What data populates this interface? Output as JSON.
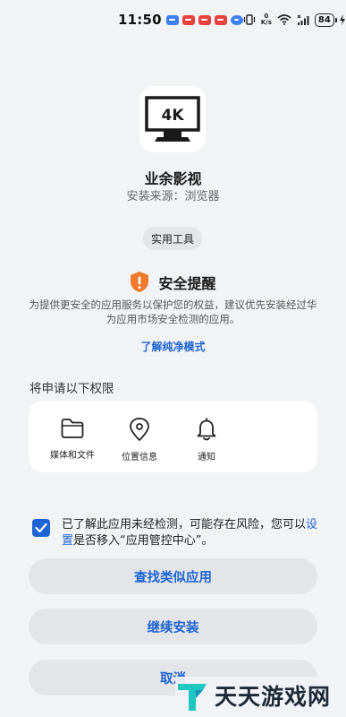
{
  "status_bar": {
    "time": "11:50",
    "net_speed_value": "0",
    "net_speed_unit": "K/s",
    "battery": "84"
  },
  "app": {
    "icon_text": "4K",
    "name": "业余影视",
    "source": "安装来源：浏览器",
    "category": "实用工具"
  },
  "security": {
    "title": "安全提醒",
    "description": "为提供更安全的应用服务以保护您的权益，建议优先安装经过华为应用市场安全检测的应用。",
    "link": "了解纯净模式"
  },
  "permissions": {
    "heading": "将申请以下权限",
    "items": [
      {
        "label": "媒体和文件",
        "icon": "folder-icon"
      },
      {
        "label": "位置信息",
        "icon": "location-pin-icon"
      },
      {
        "label": "通知",
        "icon": "bell-icon"
      }
    ]
  },
  "consent": {
    "checked": true,
    "text_before": "已了解此应用未经检测，可能存在风险，您可以",
    "link": "设置",
    "text_after": "是否移入“应用管控中心”。"
  },
  "buttons": {
    "find_similar": "查找类似应用",
    "continue_install": "继续安装",
    "cancel": "取消"
  },
  "watermark": {
    "text": "天天游戏网"
  },
  "colors": {
    "accent": "#1e64d2",
    "warning": "#ef7a2d",
    "background": "#f1f3f5"
  }
}
